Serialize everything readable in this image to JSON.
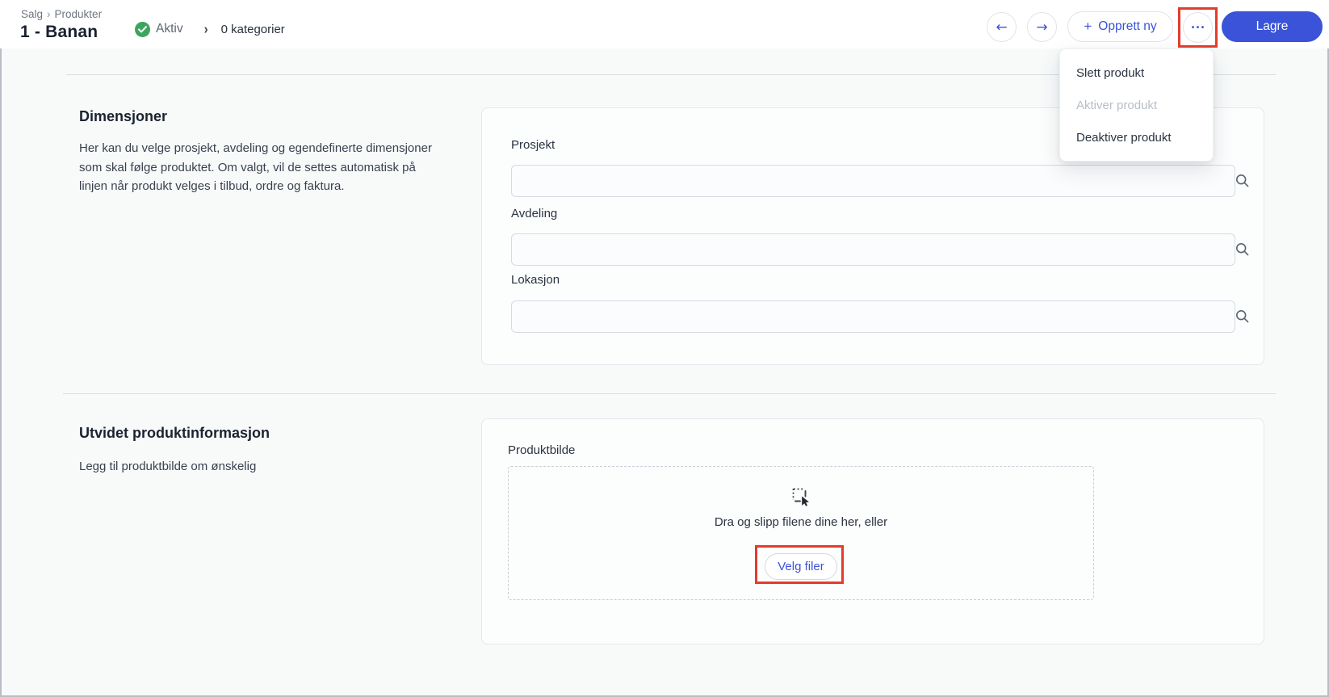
{
  "colors": {
    "accent_blue": "#3a53d9",
    "status_green": "#3da45e",
    "annotation_red": "#e23d2c",
    "page_background": "#f8fafa"
  },
  "icons": {
    "status": "check-circle-icon",
    "field": "magnifier-search-icon",
    "nav_prev": "arrow-left-icon",
    "nav_next": "arrow-right-icon",
    "more": "ellipsis-icon",
    "dropzone": "drag-select-cursor-icon"
  },
  "header": {
    "breadcrumb": {
      "section": "Salg",
      "separator": "›",
      "page": "Produkter"
    },
    "title": "1 - Banan",
    "status_label": "Aktiv",
    "status_separator": "›",
    "categories_label": "0 kategorier",
    "nav_prev_glyph": "←",
    "nav_next_glyph": "→",
    "create_plus": "+",
    "create_label": "Opprett ny",
    "more_glyph": "•••",
    "save_label": "Lagre"
  },
  "menu": {
    "items": [
      {
        "label": "Slett produkt",
        "disabled": false
      },
      {
        "label": "Aktiver produkt",
        "disabled": true
      },
      {
        "label": "Deaktiver produkt",
        "disabled": false
      }
    ]
  },
  "sections": [
    {
      "heading": "Dimensjoner",
      "description": "Her kan du velge prosjekt, avdeling og egendefinerte dimensjoner som skal følge produktet. Om valgt, vil de settes automatisk på linjen når produkt velges i tilbud, ordre og faktura.",
      "fields": [
        {
          "label": "Prosjekt",
          "value": "",
          "placeholder": ""
        },
        {
          "label": "Avdeling",
          "value": "",
          "placeholder": ""
        },
        {
          "label": "Lokasjon",
          "value": "",
          "placeholder": ""
        }
      ]
    },
    {
      "heading": "Utvidet produktinformasjon",
      "description": "Legg til produktbilde om ønskelig",
      "card_label": "Produktbilde",
      "dropzone": {
        "text": "Dra og slipp filene dine her, eller",
        "button_label": "Velg filer"
      }
    }
  ]
}
